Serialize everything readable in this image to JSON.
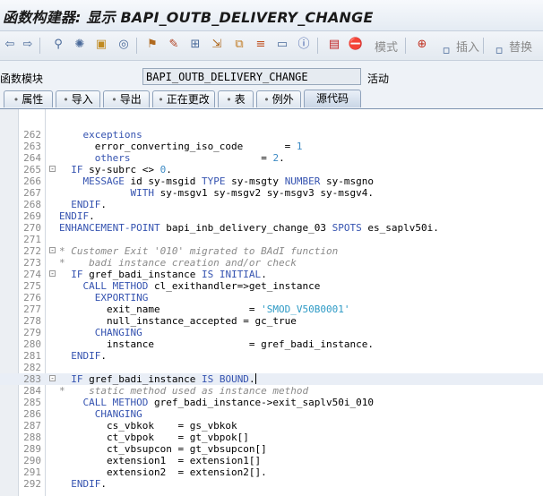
{
  "window": {
    "title": "函数构建器: 显示 BAPI_OUTB_DELIVERY_CHANGE"
  },
  "toolbar": {
    "mode_label": "模式",
    "insert_label": "插入",
    "replace_label": "替换"
  },
  "function_module": {
    "label": "函数模块",
    "value": "BAPI_OUTB_DELIVERY_CHANGE",
    "status": "活动"
  },
  "tabs": [
    {
      "label": "属性",
      "active": false
    },
    {
      "label": "导入",
      "active": false
    },
    {
      "label": "导出",
      "active": false
    },
    {
      "label": "正在更改",
      "active": false
    },
    {
      "label": "表",
      "active": false
    },
    {
      "label": "例外",
      "active": false
    },
    {
      "label": "源代码",
      "active": true
    }
  ],
  "editor": {
    "current_line": "283",
    "lines": [
      {
        "n": "262",
        "segs": [
          [
            "    exceptions",
            "kw"
          ]
        ]
      },
      {
        "n": "263",
        "segs": [
          [
            "      error_converting_iso_code       ",
            ""
          ],
          [
            "= ",
            ""
          ],
          [
            "1",
            "num"
          ]
        ]
      },
      {
        "n": "264",
        "segs": [
          [
            "      others",
            "kw"
          ],
          [
            "                      ",
            ""
          ],
          [
            "= ",
            ""
          ],
          [
            "2",
            "num"
          ],
          [
            ".",
            ""
          ]
        ]
      },
      {
        "n": "265",
        "fold": true,
        "segs": [
          [
            "  IF",
            "kw"
          ],
          [
            " sy-subrc ",
            ""
          ],
          [
            "<>",
            ""
          ],
          [
            " ",
            ""
          ],
          [
            "0",
            "num"
          ],
          [
            ".",
            ""
          ]
        ]
      },
      {
        "n": "266",
        "segs": [
          [
            "    MESSAGE",
            "kw"
          ],
          [
            " id sy-msgid ",
            ""
          ],
          [
            "TYPE",
            "kw"
          ],
          [
            " sy-msgty ",
            ""
          ],
          [
            "NUMBER",
            "kw"
          ],
          [
            " sy-msgno",
            ""
          ]
        ]
      },
      {
        "n": "267",
        "segs": [
          [
            "            WITH",
            "kw"
          ],
          [
            " sy-msgv1 sy-msgv2 sy-msgv3 sy-msgv4.",
            ""
          ]
        ]
      },
      {
        "n": "268",
        "segs": [
          [
            "  ENDIF",
            "kw"
          ],
          [
            ".",
            ""
          ]
        ]
      },
      {
        "n": "269",
        "segs": [
          [
            "ENDIF",
            "kw"
          ],
          [
            ".",
            ""
          ]
        ]
      },
      {
        "n": "270",
        "segs": [
          [
            "ENHANCEMENT-POINT",
            "kw"
          ],
          [
            " bapi_inb_delivery_change_03 ",
            ""
          ],
          [
            "SPOTS",
            "kw"
          ],
          [
            " es_saplv50i.",
            ""
          ]
        ]
      },
      {
        "n": "271",
        "segs": [
          [
            "",
            ""
          ]
        ]
      },
      {
        "n": "272",
        "fold": true,
        "segs": [
          [
            "* Customer Exit '010' migrated to BAdI function",
            "cm"
          ]
        ]
      },
      {
        "n": "273",
        "segs": [
          [
            "*    badi instance creation and/or check",
            "cm"
          ]
        ]
      },
      {
        "n": "274",
        "fold": true,
        "segs": [
          [
            "  IF",
            "kw"
          ],
          [
            " gref_badi_instance ",
            ""
          ],
          [
            "IS INITIAL",
            "kw"
          ],
          [
            ".",
            ""
          ]
        ]
      },
      {
        "n": "275",
        "segs": [
          [
            "    CALL METHOD",
            "kw"
          ],
          [
            " cl_exithandler=>get_instance",
            ""
          ]
        ]
      },
      {
        "n": "276",
        "segs": [
          [
            "      EXPORTING",
            "kw"
          ]
        ]
      },
      {
        "n": "277",
        "segs": [
          [
            "        exit_name               ",
            ""
          ],
          [
            "= ",
            ""
          ],
          [
            "'SMOD_V50B0001'",
            "str"
          ]
        ]
      },
      {
        "n": "278",
        "segs": [
          [
            "        null_instance_accepted = gc_true",
            ""
          ]
        ]
      },
      {
        "n": "279",
        "segs": [
          [
            "      CHANGING",
            "kw"
          ]
        ]
      },
      {
        "n": "280",
        "segs": [
          [
            "        instance                ",
            ""
          ],
          [
            "= gref_badi_instance.",
            ""
          ]
        ]
      },
      {
        "n": "281",
        "segs": [
          [
            "  ENDIF",
            "kw"
          ],
          [
            ".",
            ""
          ]
        ]
      },
      {
        "n": "282",
        "segs": [
          [
            "",
            ""
          ]
        ]
      },
      {
        "n": "283",
        "fold": true,
        "current": true,
        "segs": [
          [
            "  IF",
            "kw"
          ],
          [
            " gref_badi_instance ",
            ""
          ],
          [
            "IS BOUND",
            "kw"
          ],
          [
            ".",
            ""
          ]
        ]
      },
      {
        "n": "284",
        "segs": [
          [
            "*    static method used as instance method",
            "cm"
          ]
        ]
      },
      {
        "n": "285",
        "segs": [
          [
            "    CALL METHOD",
            "kw"
          ],
          [
            " gref_badi_instance->exit_saplv50i_010",
            ""
          ]
        ]
      },
      {
        "n": "286",
        "segs": [
          [
            "      CHANGING",
            "kw"
          ]
        ]
      },
      {
        "n": "287",
        "segs": [
          [
            "        cs_vbkok    = gs_vbkok",
            ""
          ]
        ]
      },
      {
        "n": "288",
        "segs": [
          [
            "        ct_vbpok    = gt_vbpok[]",
            ""
          ]
        ]
      },
      {
        "n": "289",
        "segs": [
          [
            "        ct_vbsupcon = gt_vbsupcon[]",
            ""
          ]
        ]
      },
      {
        "n": "290",
        "segs": [
          [
            "        extension1  = extension1[]",
            ""
          ]
        ]
      },
      {
        "n": "291",
        "segs": [
          [
            "        extension2  = extension2[].",
            ""
          ]
        ]
      },
      {
        "n": "292",
        "segs": [
          [
            "  ENDIF",
            "kw"
          ],
          [
            ".",
            ""
          ]
        ]
      }
    ]
  }
}
